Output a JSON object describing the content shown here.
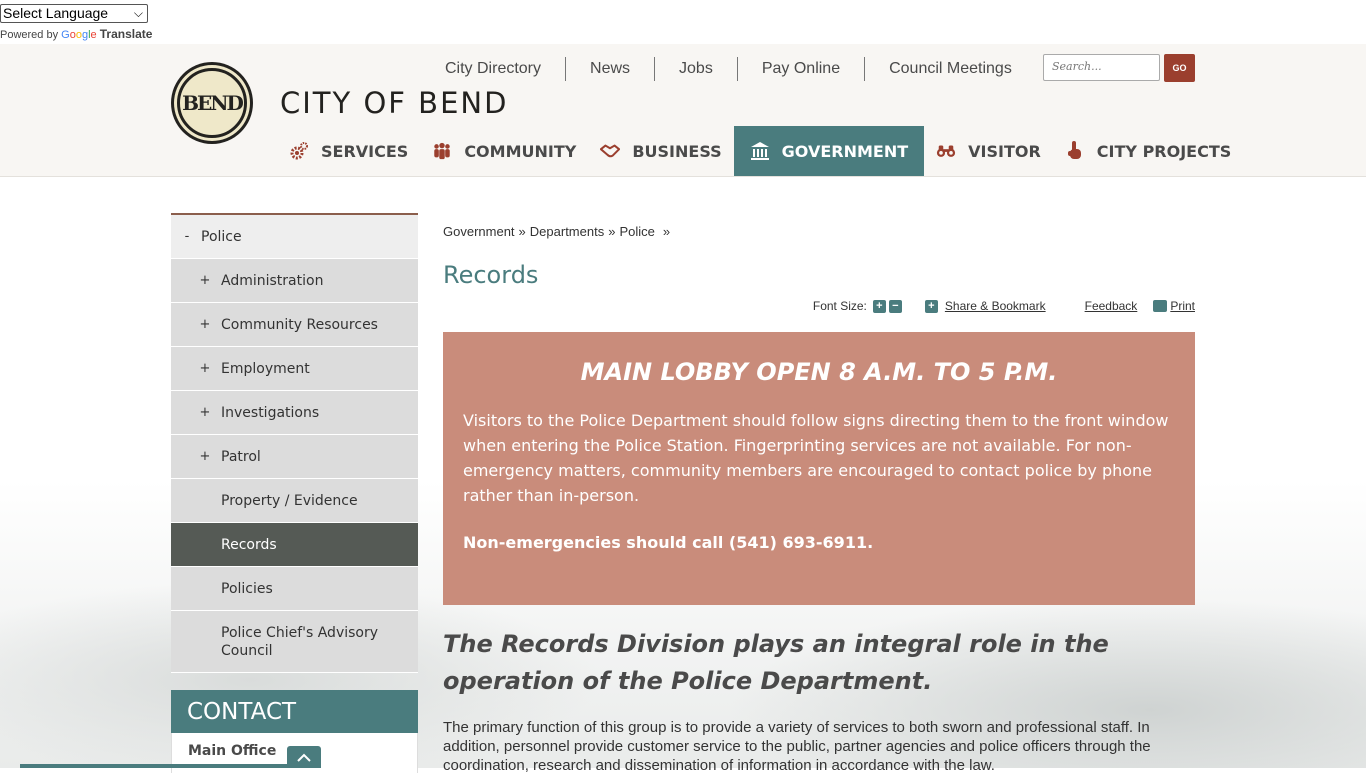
{
  "translate": {
    "select_label": "Select Language",
    "powered_by": "Powered by",
    "google": "Google",
    "translate": "Translate"
  },
  "header": {
    "logo_seal_text": "BEND",
    "logo_text": "CITY OF BEND",
    "utility_links": [
      "City Directory",
      "News",
      "Jobs",
      "Pay Online",
      "Council Meetings"
    ],
    "search_placeholder": "Search...",
    "search_button": "GO"
  },
  "main_nav": [
    {
      "label": "SERVICES",
      "icon": "gears-icon",
      "active": false
    },
    {
      "label": "COMMUNITY",
      "icon": "people-icon",
      "active": false
    },
    {
      "label": "BUSINESS",
      "icon": "handshake-icon",
      "active": false
    },
    {
      "label": "GOVERNMENT",
      "icon": "building-icon",
      "active": true
    },
    {
      "label": "VISITOR",
      "icon": "binoculars-icon",
      "active": false
    },
    {
      "label": "CITY PROJECTS",
      "icon": "hand-pointer-icon",
      "active": false
    }
  ],
  "sidebar": {
    "parent": {
      "mark": "-",
      "label": "Police"
    },
    "items": [
      {
        "mark": "+",
        "label": "Administration"
      },
      {
        "mark": "+",
        "label": "Community Resources"
      },
      {
        "mark": "+",
        "label": "Employment"
      },
      {
        "mark": "+",
        "label": "Investigations"
      },
      {
        "mark": "+",
        "label": "Patrol"
      },
      {
        "mark": "",
        "label": "Property / Evidence"
      },
      {
        "mark": "",
        "label": "Records",
        "active": true
      },
      {
        "mark": "",
        "label": "Policies"
      },
      {
        "mark": "",
        "label": "Police Chief's Advisory Council"
      }
    ],
    "contact_title": "CONTACT",
    "contact_office": "Main Office"
  },
  "breadcrumb": [
    "Government",
    "Departments",
    "Police"
  ],
  "breadcrumb_sep": "»",
  "page_title": "Records",
  "tools": {
    "font_size_label": "Font Size:",
    "plus": "+",
    "minus": "−",
    "share_label": "Share & Bookmark",
    "feedback_label": "Feedback",
    "print_label": "Print"
  },
  "alert": {
    "heading": "MAIN LOBBY OPEN 8 A.M. TO 5 P.M.",
    "body": "Visitors to the Police Department should follow signs directing them to the front window when entering the Police Station. Fingerprinting services are not available. For non-emergency matters, community members are encouraged to contact police by phone rather than in-person.",
    "phone_line": "Non-emergencies should call (541) 693-6911."
  },
  "intro": {
    "heading": "The Records Division plays an integral role in the operation of the Police Department.",
    "paragraph": "The primary function of this group is to provide a variety of services to both sworn and professional staff. In addition, personnel provide customer service to the public, partner agencies and police officers through the coordination, research and dissemination of information in accordance with the law."
  },
  "colors": {
    "teal": "#4a7c7e",
    "rust": "#9b3f2e",
    "alert_bg": "#c98c7b",
    "sidebar_active": "#555a55"
  }
}
